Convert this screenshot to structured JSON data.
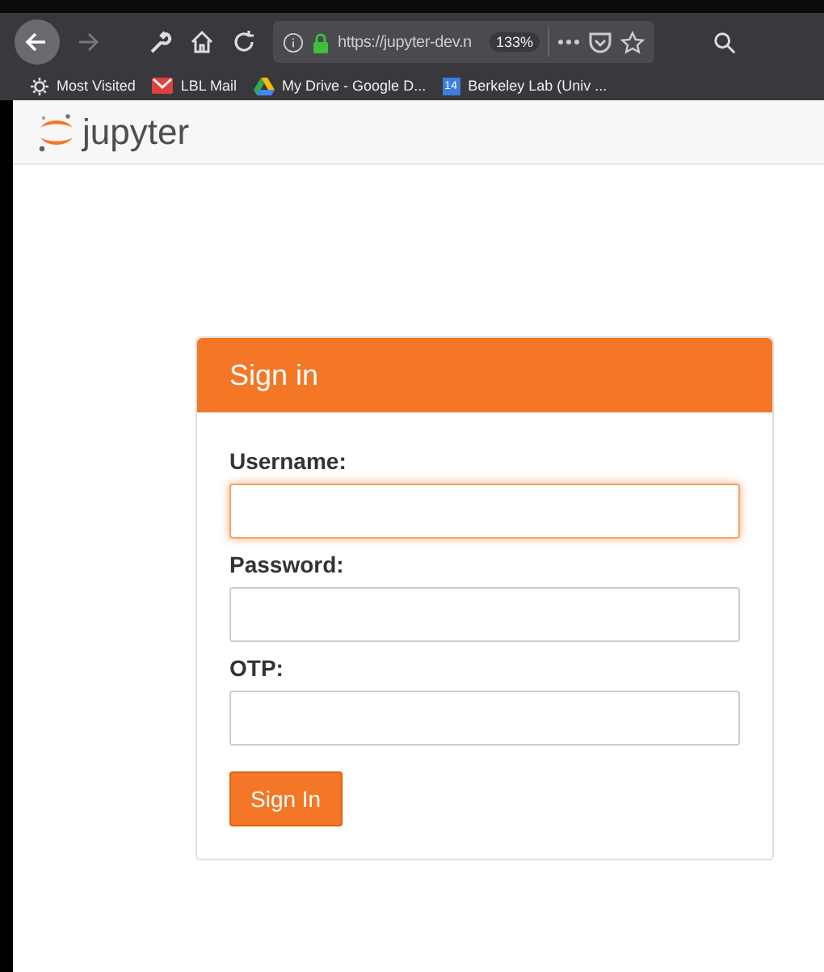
{
  "browser": {
    "url": "https://jupyter-dev.n",
    "zoom": "133%",
    "bookmarks": [
      {
        "label": "Most Visited",
        "kind": "gear"
      },
      {
        "label": "LBL Mail",
        "kind": "mail"
      },
      {
        "label": "My Drive - Google D...",
        "kind": "drive"
      },
      {
        "label": "Berkeley Lab (Univ ...",
        "kind": "calendar",
        "badge": "14"
      }
    ]
  },
  "header": {
    "logo_text": "jupyter"
  },
  "login": {
    "title": "Sign in",
    "fields": [
      {
        "label": "Username:",
        "focused": true
      },
      {
        "label": "Password:",
        "focused": false
      },
      {
        "label": "OTP:",
        "focused": false
      }
    ],
    "button": "Sign In"
  }
}
